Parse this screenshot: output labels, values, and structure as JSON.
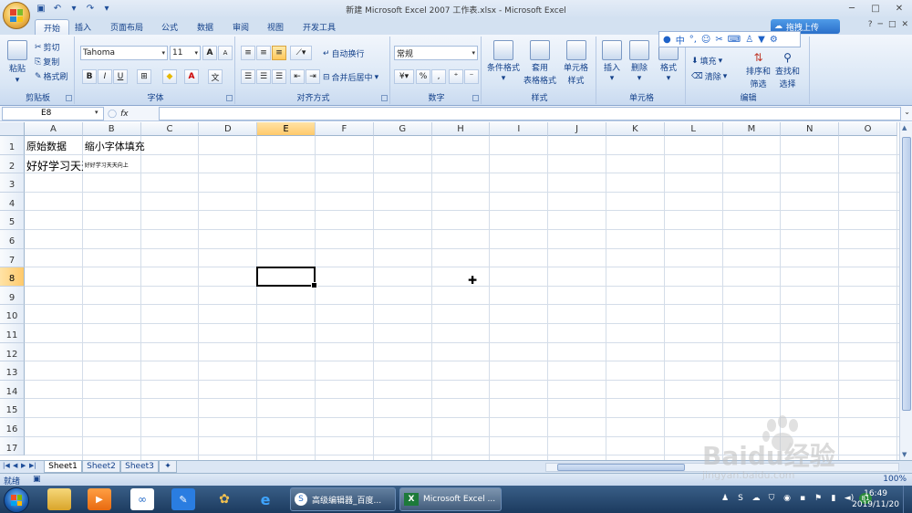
{
  "window": {
    "title": "新建 Microsoft Excel 2007 工作表.xlsx - Microsoft Excel",
    "ctrl_min": "─",
    "ctrl_max": "□",
    "ctrl_close": "✕"
  },
  "tabs": [
    "开始",
    "插入",
    "页面布局",
    "公式",
    "数据",
    "审阅",
    "视图",
    "开发工具"
  ],
  "upload_label": "拖拽上传",
  "ribbon": {
    "clipboard": {
      "label": "剪贴板",
      "paste": "粘贴",
      "cut": "剪切",
      "copy": "复制",
      "format_painter": "格式刷"
    },
    "font": {
      "label": "字体",
      "font_name": "Tahoma",
      "font_size": "11",
      "bold": "B",
      "italic": "I",
      "underline": "U",
      "grow": "A",
      "shrink": "A",
      "font_color_glyph": "A"
    },
    "alignment": {
      "label": "对齐方式",
      "wrap": "自动换行",
      "merge": "合并后居中"
    },
    "number": {
      "label": "数字",
      "format": "常规",
      "percent": "%"
    },
    "styles": {
      "label": "样式",
      "conditional": "条件格式",
      "table_1": "套用",
      "table_2": "表格格式",
      "cell_style_1": "单元格",
      "cell_style_2": "样式"
    },
    "cells": {
      "label": "单元格",
      "insert": "插入",
      "delete": "删除",
      "format": "格式"
    },
    "editing": {
      "label": "编辑",
      "fill": "填充",
      "clear": "清除",
      "sort_1": "排序和",
      "sort_2": "筛选",
      "find_1": "查找和",
      "find_2": "选择"
    }
  },
  "floatbar_lang": "中",
  "formula_bar": {
    "name_box": "E8",
    "fx": "fx",
    "content": ""
  },
  "columns": [
    "A",
    "B",
    "C",
    "D",
    "E",
    "F",
    "G",
    "H",
    "I",
    "J",
    "K",
    "L",
    "M",
    "N",
    "O"
  ],
  "rows": [
    "1",
    "2",
    "3",
    "4",
    "5",
    "6",
    "7",
    "8",
    "9",
    "10",
    "11",
    "12",
    "13",
    "14",
    "15",
    "16",
    "17"
  ],
  "cells": {
    "A1": "原始数据",
    "B1": "缩小字体填充",
    "A2": "好好学习天天向上",
    "B2": "好好学习天天向上"
  },
  "selected_cell": "E8",
  "sheets": [
    "Sheet1",
    "Sheet2",
    "Sheet3"
  ],
  "status": {
    "ready": "就绪",
    "zoom": "100%"
  },
  "taskbar": {
    "tasks": [
      "高级编辑器_百度...",
      "Microsoft Excel ..."
    ],
    "time": "16:49",
    "date": "2019/11/20",
    "badge": "81"
  },
  "watermark": {
    "brand": "Baidu经验",
    "url": "jingyan.baidu.com"
  },
  "colors": {
    "accent": "#15428b",
    "selection": "#ffc96b",
    "excel_green": "#1d7a3a"
  }
}
